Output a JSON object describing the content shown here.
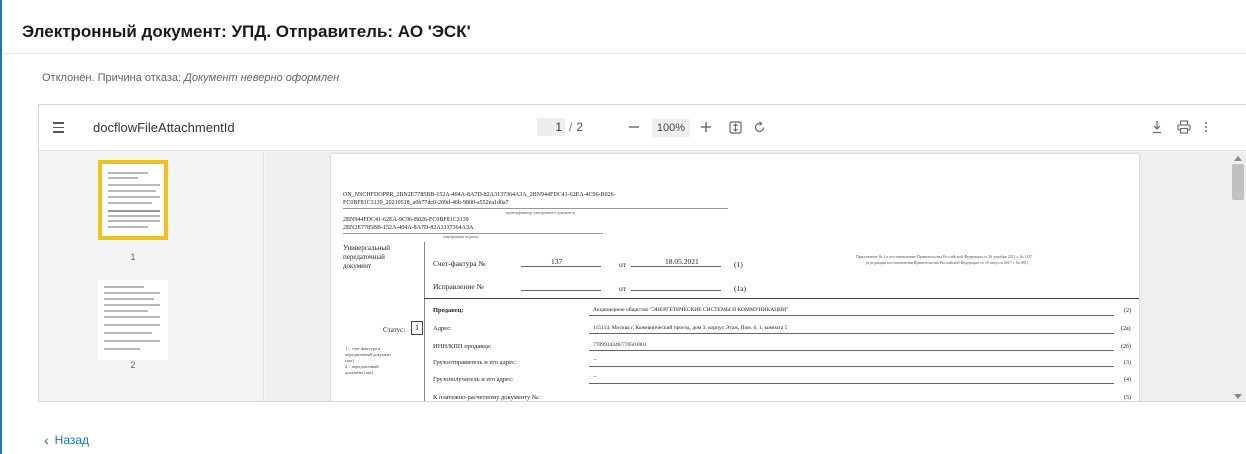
{
  "header": {
    "title": "Электронный документ: УПД. Отправитель: АО 'ЭСК'"
  },
  "status": {
    "prefix": "Отклонён. Причина отказа:",
    "reason": "Документ неверно оформлен"
  },
  "viewer": {
    "filename": "docflowFileAttachmentId",
    "current_page": "1",
    "page_sep": "/",
    "total_pages": "2",
    "zoom": "100%",
    "icons": {
      "menu": "menu-icon",
      "zoom_out": "minus-icon",
      "zoom_in": "plus-icon",
      "fit": "fit-page-icon",
      "rotate": "rotate-icon",
      "download": "download-icon",
      "print": "print-icon",
      "more": "more-vert-icon"
    },
    "thumbnails": [
      {
        "label": "1",
        "active": true
      },
      {
        "label": "2",
        "active": false
      }
    ]
  },
  "document": {
    "id_line1": "ON_NSCHFDOPPR_2BN2E7785BB-152A-404A-8A7D-82A3137364A3A_2BN944FDC41-62EA-4C96-B026-",
    "id_line2": "FC0BF81C3139_20210518_a0b77dc0-209d-46b-9800-a552ea1d0a7",
    "id_caption1": "идентификатор электронного документа",
    "sender_line1": "2BN944FDC41-62EA-9C96-B026-FC0BF81C3139",
    "sender_line2": "2BN2E7785BB-152A-404A-8A7D-82A3137364A3A",
    "sender_caption": "электронная подпись",
    "upd_title1": "Универсальный",
    "upd_title2": "передаточный",
    "upd_title3": "документ",
    "invoice_label": "Счет-фактура №",
    "invoice_number": "137",
    "from_label": "от",
    "invoice_date": "18.05.2021",
    "invoice_code": "(1)",
    "correction_label": "Исправление №",
    "correction_code": "(1а)",
    "appendix1": "Приложение № 1 к постановлению Правительства Российской Федерации от 26 декабря 2011 г. № 1137",
    "appendix2": "(в редакции постановления Правительства Российской Федерации от 19 августа 2017 г. № 981)",
    "status_label": "Статус:",
    "status_value": "1",
    "status_note1": "1 – счет-фактура и",
    "status_note2": "передаточный документ",
    "status_note3": "(акт)",
    "status_note4": "2 – передаточный",
    "status_note5": "документ (акт)",
    "seller_label": "Продавец:",
    "seller_value": "Акционерное общество \"ЭНЕРГЕТИЧЕСКИЕ СИСТЕМЫ И КОММУНИКАЦИИ\"",
    "seller_code": "(2)",
    "address_label": "Адрес:",
    "address_value": "115114, Москва г, Кожевнический проезд, дом 3, корпус Этаж, Пом. 6, 1, комната 5",
    "address_code": "(2а)",
    "inn_label": "ИНН/КПП продавца:",
    "inn_value": "7709934346/770501001",
    "inn_code": "(2б)",
    "shipper_label": "Грузоотправитель и его адрес:",
    "shipper_value": "--",
    "shipper_code": "(3)",
    "consignee_label": "Грузополучатель и его адрес:",
    "consignee_value": "--",
    "consignee_code": "(4)",
    "payment_label": "К платежно-расчетному документу №:",
    "payment_code": "(5)"
  },
  "footer": {
    "back_label": "Назад"
  }
}
